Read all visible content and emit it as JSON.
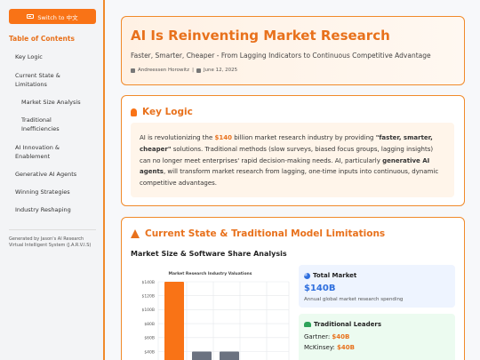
{
  "sidebar": {
    "lang_button": "Switch to 中文",
    "toc_title": "Table of Contents",
    "items": [
      {
        "label": "Key Logic"
      },
      {
        "label": "Current State & Limitations"
      },
      {
        "label": "Market Size Analysis"
      },
      {
        "label": "Traditional Inefficiencies"
      },
      {
        "label": "AI Innovation & Enablement"
      },
      {
        "label": "Generative AI Agents"
      },
      {
        "label": "Winning Strategies"
      },
      {
        "label": "Industry Reshaping"
      }
    ],
    "footer": "Generated by Jason's AI Research Virtual Intelligent System (J.A.R.V.I.S)"
  },
  "hero": {
    "title": "AI Is Reinventing Market Research",
    "subtitle": "Faster, Smarter, Cheaper - From Lagging Indicators to Continuous Competitive Advantage",
    "author": "Andreessen Horowitz",
    "separator": "|",
    "date": "June 12, 2025"
  },
  "key_logic": {
    "title": "Key Logic",
    "p1": "AI is revolutionizing the ",
    "amount": "$140",
    "p2": " billion market research industry by providing ",
    "bold1": "\"faster, smarter, cheaper\"",
    "p3": " solutions. Traditional methods (slow surveys, biased focus groups, lagging insights) can no longer meet enterprises' rapid decision-making needs. AI, particularly ",
    "bold2": "generative AI agents",
    "p4": ", will transform market research from lagging, one-time inputs into continuous, dynamic competitive advantages."
  },
  "current_state": {
    "title": "Current State & Traditional Model Limitations",
    "subtitle": "Market Size & Software Share Analysis",
    "total_market": {
      "label": "Total Market",
      "value": "$140B",
      "desc": "Annual global market research spending"
    },
    "leaders": {
      "label": "Traditional Leaders",
      "items": [
        {
          "name": "Gartner: ",
          "value": "$40B"
        },
        {
          "name": "McKinsey: ",
          "value": "$40B"
        }
      ]
    }
  },
  "chart_data": {
    "type": "bar",
    "title": "Market Research Industry Valuations",
    "y_ticks": [
      "$140B",
      "$120B",
      "$100B",
      "$80B",
      "$60B",
      "$40B"
    ],
    "ylim": [
      0,
      140
    ],
    "values": [
      140,
      40,
      40
    ],
    "colors": [
      "#f97316",
      "#6b7280",
      "#6b7280"
    ],
    "grid": true
  }
}
